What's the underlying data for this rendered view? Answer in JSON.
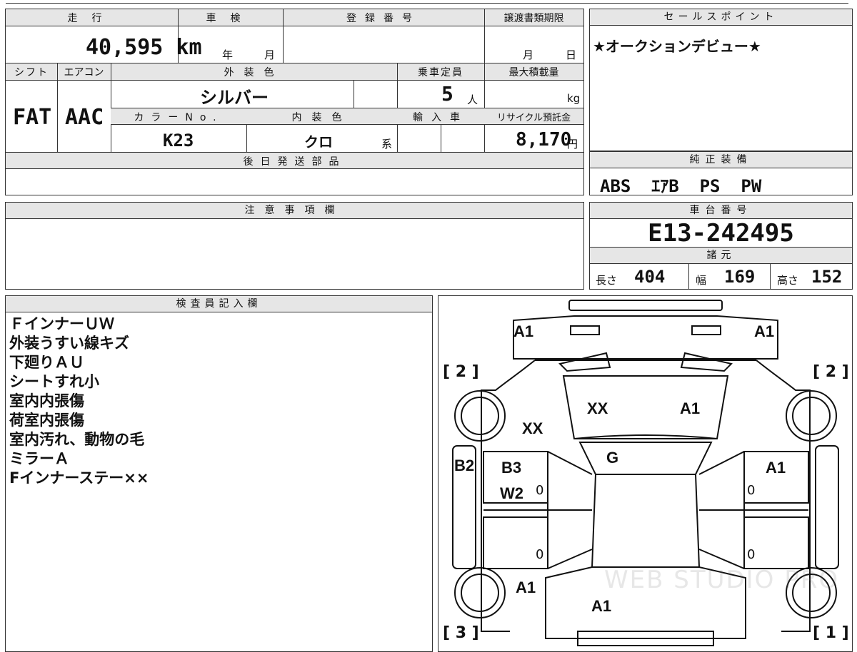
{
  "mileage": {
    "label": "走行",
    "value": "40,595 km"
  },
  "inspection": {
    "label": "車検",
    "year_label": "年",
    "month_label": "月"
  },
  "registration_number": {
    "label": "登録番号",
    "value": ""
  },
  "transfer_deadline": {
    "label": "譲渡書類期限",
    "month_label": "月",
    "day_label": "日"
  },
  "sales_point": {
    "label": "セールスポイント",
    "text": "★オークションデビュー★"
  },
  "shift": {
    "label": "シフト",
    "value": "FAT"
  },
  "aircon": {
    "label": "エアコン",
    "value": "AAC"
  },
  "exterior_color": {
    "label": "外装色",
    "value": "シルバー"
  },
  "capacity": {
    "label": "乗車定員",
    "value": "5",
    "unit": "人"
  },
  "max_load": {
    "label": "最大積載量",
    "value": "",
    "unit": "kg"
  },
  "color_no": {
    "label": "カラーNo.",
    "value": "K23"
  },
  "interior_color": {
    "label": "内装色",
    "value": "クロ",
    "suffix": "系"
  },
  "import": {
    "label": "輸入車",
    "value": ""
  },
  "recycle_fee": {
    "label": "リサイクル預託金",
    "value": "8,170",
    "unit": "円"
  },
  "later_parts": {
    "label": "後日発送部品",
    "value": ""
  },
  "genuine_equipment": {
    "label": "純正装備",
    "value": "ABS  ｴｱB  PS  PW"
  },
  "notes": {
    "label": "注意事項欄",
    "value": ""
  },
  "chassis_number": {
    "label": "車台番号",
    "value": "E13-242495"
  },
  "specs": {
    "label": "諸元",
    "length_label": "長さ",
    "length": "404",
    "width_label": "幅",
    "width": "169",
    "height_label": "高さ",
    "height": "152"
  },
  "inspector_notes": {
    "label": "検査員記入欄",
    "lines": [
      "ＦインナーＵＷ",
      "外装うすい線キズ",
      "下廻りＡＵ",
      "シートすれ小",
      "室内内張傷",
      "荷室内張傷",
      "室内汚れ、動物の毛",
      "ミラーＡ",
      "Fインナーステー××"
    ]
  },
  "damage_map": {
    "marks": [
      "A1",
      "A1",
      "XX",
      "A1",
      "XX",
      "G",
      "B2",
      "B3",
      "W2",
      "A1",
      "A1",
      "A1"
    ],
    "zeros": [
      "0",
      "0",
      "0",
      "0"
    ],
    "tire_labels": [
      "[ 2 ]",
      "[ 2 ]",
      "[ 3 ]",
      "[ 1 ]"
    ]
  },
  "watermark": "WEB STUDIO PRO"
}
